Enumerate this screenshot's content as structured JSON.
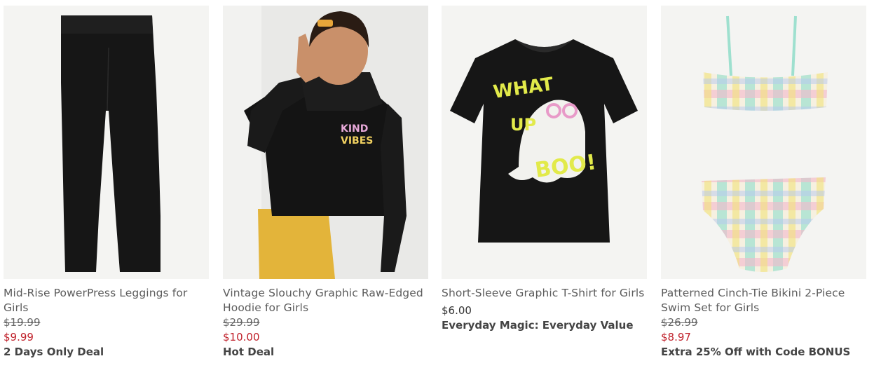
{
  "products": [
    {
      "name": "Mid-Rise PowerPress Leggings for Girls",
      "original_price": "$19.99",
      "sale_price": "$9.99",
      "badge": "2 Days Only Deal"
    },
    {
      "name": "Vintage Slouchy Graphic Raw-Edged Hoodie for Girls",
      "original_price": "$29.99",
      "sale_price": "$10.00",
      "badge": "Hot Deal",
      "graphic_text": [
        "KIND",
        "VIBES"
      ]
    },
    {
      "name": "Short-Sleeve Graphic T-Shirt for Girls",
      "price": "$6.00",
      "badge": "Everyday Magic: Everyday Value",
      "graphic_text": [
        "WHAT",
        "UP",
        "BOO!"
      ]
    },
    {
      "name": "Patterned Cinch-Tie Bikini 2-Piece Swim Set for Girls",
      "original_price": "$26.99",
      "sale_price": "$8.97",
      "badge": "Extra 25% Off with Code BONUS"
    }
  ],
  "colors": {
    "sale": "#c0202a",
    "text": "#5c5c5c",
    "image_bg": "#f3f3f1"
  }
}
